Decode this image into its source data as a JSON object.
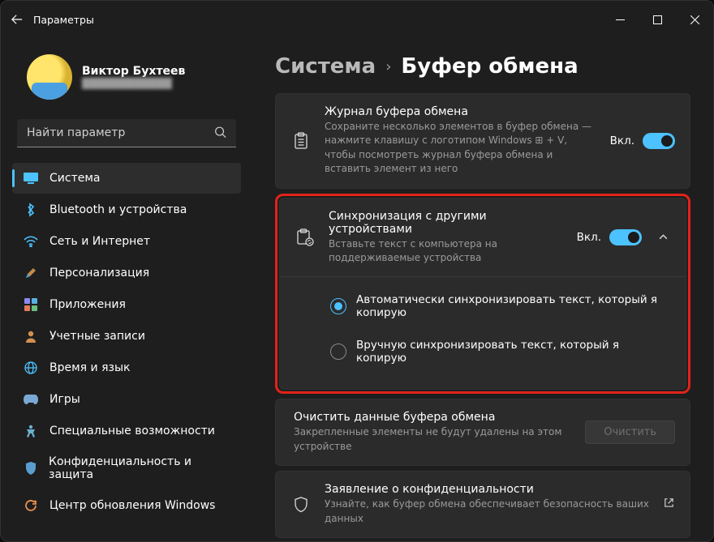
{
  "window": {
    "title": "Параметры"
  },
  "profile": {
    "name": "Виктор Бухтеев",
    "subtitle": "████████████"
  },
  "search": {
    "placeholder": "Найти параметр"
  },
  "nav": [
    {
      "label": "Система",
      "icon": "🖥️",
      "active": true
    },
    {
      "label": "Bluetooth и устройства",
      "icon": "bt"
    },
    {
      "label": "Сеть и Интернет",
      "icon": "wifi"
    },
    {
      "label": "Персонализация",
      "icon": "🖌️"
    },
    {
      "label": "Приложения",
      "icon": "apps"
    },
    {
      "label": "Учетные записи",
      "icon": "👤"
    },
    {
      "label": "Время и язык",
      "icon": "🌐"
    },
    {
      "label": "Игры",
      "icon": "🎮"
    },
    {
      "label": "Специальные возможности",
      "icon": "acc"
    },
    {
      "label": "Конфиденциальность и защита",
      "icon": "🛡️"
    },
    {
      "label": "Центр обновления Windows",
      "icon": "🔄"
    }
  ],
  "breadcrumb": {
    "parent": "Система",
    "current": "Буфер обмена"
  },
  "cards": {
    "history": {
      "title": "Журнал буфера обмена",
      "sub": "Сохраните несколько элементов в буфер обмена — нажмите клавишу с логотипом Windows ⊞ + V, чтобы посмотреть журнал буфера обмена и вставить элемент из него",
      "state": "Вкл."
    },
    "sync": {
      "title": "Синхронизация с другими устройствами",
      "sub": "Вставьте текст с компьютера на поддерживаемые устройства",
      "state": "Вкл.",
      "opt1": "Автоматически синхронизировать текст, который я копирую",
      "opt2": "Вручную синхронизировать текст, который я копирую"
    },
    "clear": {
      "title": "Очистить данные буфера обмена",
      "sub": "Закрепленные элементы не будут удалены на этом устройстве",
      "button": "Очистить"
    },
    "privacy": {
      "title": "Заявление о конфиденциальности",
      "sub": "Узнайте, как буфер обмена обеспечивает безопасность ваших данных"
    }
  }
}
